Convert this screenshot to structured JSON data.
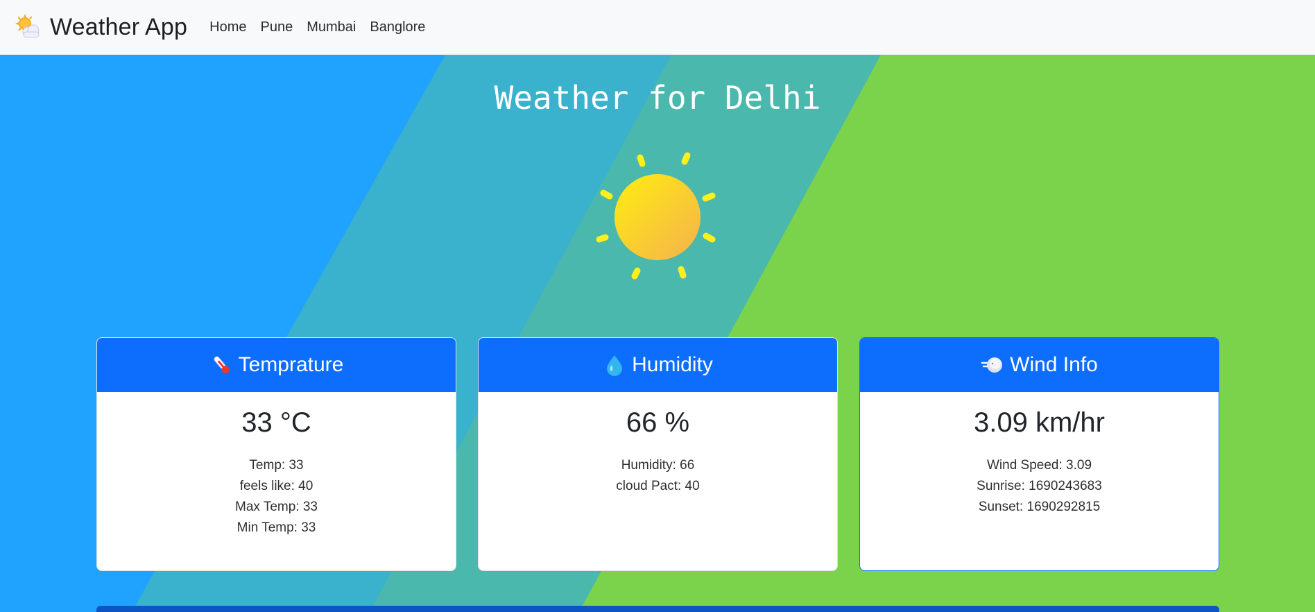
{
  "navbar": {
    "brand": "Weather App",
    "brand_icon": "sun-behind-cloud-icon",
    "links": [
      "Home",
      "Pune",
      "Mumbai",
      "Banglore"
    ]
  },
  "hero": {
    "title": "Weather for Delhi",
    "icon": "sun-icon",
    "colors": {
      "blue": "#20a3ff",
      "teal": "#3bb1c8",
      "green": "#7bd34c",
      "accent": "#0d6efd"
    }
  },
  "cards": [
    {
      "icon": "thermometer-icon",
      "title": "Temprature",
      "value": "33 °C",
      "lines": [
        "Temp: 33",
        "feels like: 40",
        "Max Temp: 33",
        "Min Temp: 33"
      ]
    },
    {
      "icon": "droplet-icon",
      "title": "Humidity",
      "value": "66 %",
      "lines": [
        "Humidity: 66",
        "cloud Pact: 40"
      ]
    },
    {
      "icon": "wind-face-icon",
      "title": "Wind Info",
      "value": "3.09 km/hr",
      "lines": [
        "Wind Speed: 3.09",
        "Sunrise: 1690243683",
        "Sunset: 1690292815"
      ]
    }
  ]
}
